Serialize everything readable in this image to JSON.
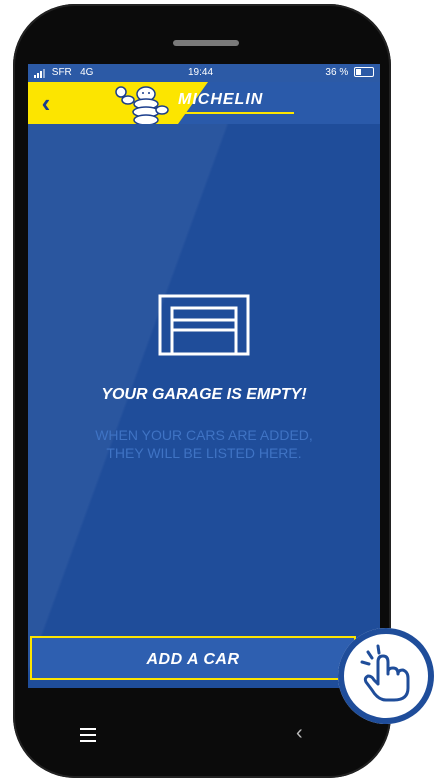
{
  "status_bar": {
    "carrier": "SFR",
    "network": "4G",
    "time": "19:44",
    "battery_text": "36 %",
    "battery_level": 0.36
  },
  "header": {
    "back_icon": "chevron-left-icon",
    "brand": "MICHELIN"
  },
  "empty_state": {
    "icon": "garage-door-icon",
    "title": "YOUR GARAGE IS EMPTY!",
    "subtitle": "WHEN YOUR CARS ARE ADDED,\nTHEY WILL BE LISTED HERE."
  },
  "actions": {
    "add_car_label": "ADD A CAR"
  },
  "android_nav": {
    "menu_icon": "hamburger-menu-icon",
    "back_icon": "back-chevron-icon"
  },
  "colors": {
    "background": "#1f4d9a",
    "accent_yellow": "#fce500",
    "text_muted": "#3f73c4"
  }
}
